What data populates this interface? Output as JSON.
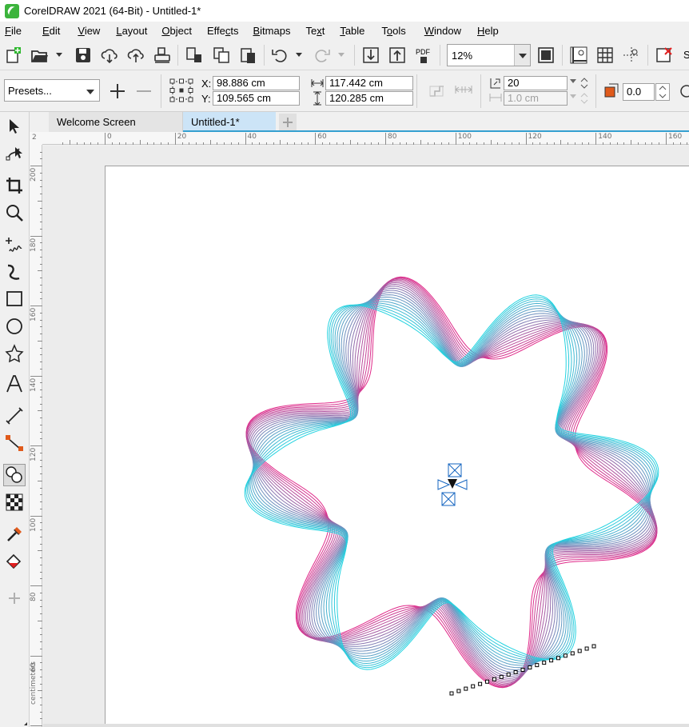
{
  "window": {
    "title": "CorelDRAW 2021 (64-Bit) - Untitled-1*"
  },
  "menu": [
    {
      "pre": "",
      "key": "F",
      "post": "ile"
    },
    {
      "pre": "",
      "key": "E",
      "post": "dit"
    },
    {
      "pre": "",
      "key": "V",
      "post": "iew"
    },
    {
      "pre": "",
      "key": "L",
      "post": "ayout"
    },
    {
      "pre": "",
      "key": "O",
      "post": "bject"
    },
    {
      "pre": "Effe",
      "key": "c",
      "post": "ts"
    },
    {
      "pre": "",
      "key": "B",
      "post": "itmaps"
    },
    {
      "pre": "Te",
      "key": "x",
      "post": "t"
    },
    {
      "pre": "",
      "key": "T",
      "post": "able"
    },
    {
      "pre": "T",
      "key": "o",
      "post": "ols"
    },
    {
      "pre": "",
      "key": "W",
      "post": "indow"
    },
    {
      "pre": "",
      "key": "H",
      "post": "elp"
    }
  ],
  "toolbar": {
    "zoom": "12%",
    "pdf_label": "PDF",
    "cut_label": "S"
  },
  "property_bar": {
    "presets": "Presets...",
    "x_label": "X:",
    "x_value": "98.886 cm",
    "y_label": "Y:",
    "y_value": "109.565 cm",
    "width_value": "117.442 cm",
    "height_value": "120.285 cm",
    "steps_value": "20",
    "spacing_value": "1.0 cm",
    "rotation_value": "0.0"
  },
  "tabs": {
    "welcome": "Welcome Screen",
    "document": "Untitled-1*"
  },
  "ruler": {
    "top_ticks": [
      "0",
      "20",
      "40",
      "60",
      "80",
      "100",
      "120",
      "140",
      "160"
    ],
    "top_partial": "2",
    "left_ticks": [
      "200",
      "180",
      "160",
      "140",
      "120",
      "100",
      "80",
      "60"
    ],
    "units": "centimeters"
  },
  "colors": {
    "start": "#e02b8a",
    "end": "#22d3e0",
    "accent": "#35a0d0"
  }
}
